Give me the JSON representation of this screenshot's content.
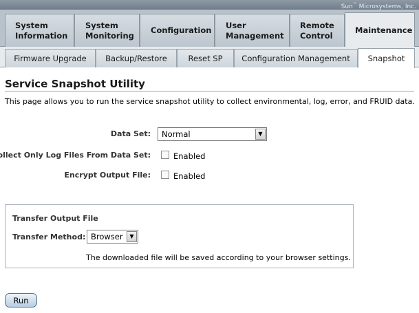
{
  "brand": {
    "text": "Sun",
    "suffix": " Microsystems, Inc."
  },
  "main_tabs": [
    {
      "label": "System\nInformation"
    },
    {
      "label": "System\nMonitoring"
    },
    {
      "label": "Configuration"
    },
    {
      "label": "User\nManagement"
    },
    {
      "label": "Remote\nControl"
    },
    {
      "label": "Maintenance",
      "active": true
    }
  ],
  "sub_tabs": [
    {
      "label": "Firmware Upgrade"
    },
    {
      "label": "Backup/Restore"
    },
    {
      "label": "Reset SP"
    },
    {
      "label": "Configuration Management"
    },
    {
      "label": "Snapshot",
      "active": true
    }
  ],
  "page": {
    "title": "Service Snapshot Utility",
    "description": "This page allows you to run the service snapshot utility to collect environmental, log, error, and FRUID data."
  },
  "form": {
    "data_set_label": "Data Set:",
    "data_set_value": "Normal",
    "collect_logs_label": "Collect Only Log Files From Data Set:",
    "collect_logs_checkbox_label": "Enabled",
    "collect_logs_checked": false,
    "encrypt_label": "Encrypt Output File:",
    "encrypt_checkbox_label": "Enabled",
    "encrypt_checked": false
  },
  "transfer": {
    "section_title": "Transfer Output File",
    "method_label": "Transfer Method:",
    "method_value": "Browser",
    "note": "The downloaded file will be saved according to your browser settings."
  },
  "run_button": "Run",
  "icons": {
    "dropdown": "chevron-down-icon"
  }
}
